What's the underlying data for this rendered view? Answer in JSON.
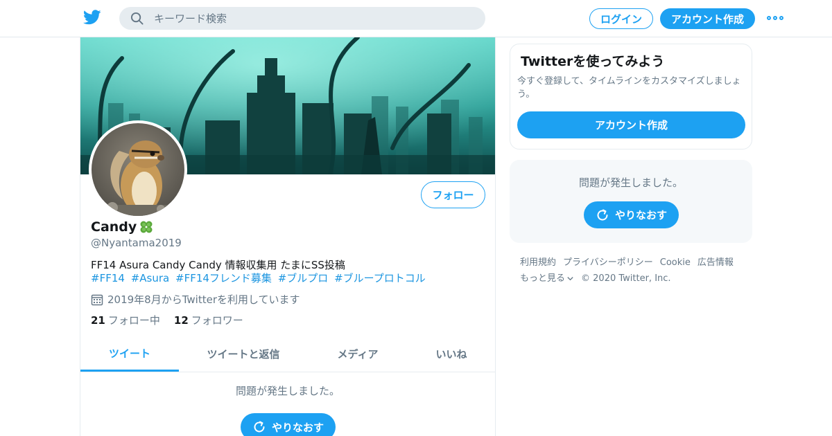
{
  "header": {
    "search_placeholder": "キーワード検索",
    "login_label": "ログイン",
    "signup_label": "アカウント作成",
    "more_icon": "more-horizontal-icon",
    "logo_icon": "twitter-bird-icon"
  },
  "profile": {
    "display_name": "Candy",
    "name_emoji": "four-leaf-clover-icon",
    "handle": "@Nyantama2019",
    "follow_label": "フォロー",
    "bio": "FF14 Asura  Candy Candy  情報収集用 たまにSS投稿",
    "hashtags": [
      "#FF14",
      "#Asura",
      "#FF14フレンド募集",
      "#ブルプロ",
      "#ブループロトコル"
    ],
    "joined": "2019年8月からTwitterを利用しています",
    "following_count": "21",
    "following_label": "フォロー中",
    "followers_count": "12",
    "followers_label": "フォロワー"
  },
  "tabs": [
    {
      "label": "ツイート",
      "active": true
    },
    {
      "label": "ツイートと返信",
      "active": false
    },
    {
      "label": "メディア",
      "active": false
    },
    {
      "label": "いいね",
      "active": false
    }
  ],
  "timeline": {
    "error_message": "問題が発生しました。",
    "retry_label": "やりなおす"
  },
  "sidebar": {
    "signup_card": {
      "title": "Twitterを使ってみよう",
      "description": "今すぐ登録して、タイムラインをカスタマイズしましょう。",
      "cta_label": "アカウント作成"
    },
    "error_card": {
      "message": "問題が発生しました。",
      "retry_label": "やりなおす"
    },
    "footer": {
      "links": [
        "利用規約",
        "プライバシーポリシー",
        "Cookie",
        "広告情報"
      ],
      "more_label": "もっと見る",
      "copyright": "© 2020 Twitter, Inc."
    }
  },
  "colors": {
    "accent": "#1da1f2",
    "link": "#1b95e0",
    "secondary_text": "#657786",
    "border": "#e6ecf0"
  }
}
